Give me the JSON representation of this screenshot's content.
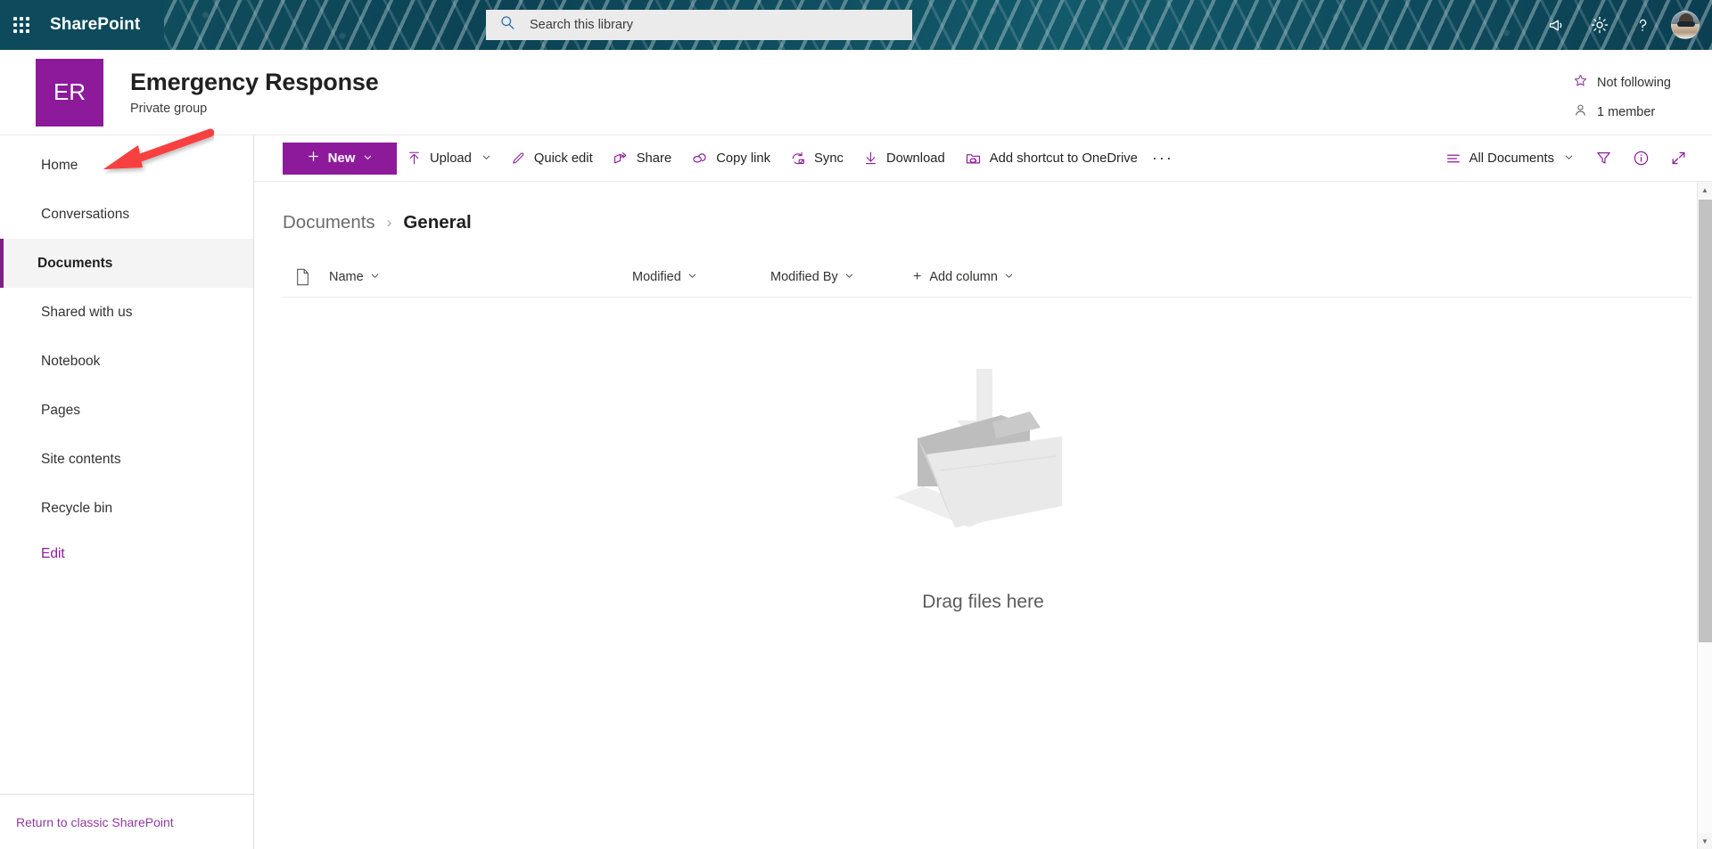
{
  "suite": {
    "brand": "SharePoint",
    "waffle_label": "app-launcher",
    "search": {
      "value": "",
      "placeholder": "Search this library"
    },
    "icons": [
      {
        "name": "megaphone-icon",
        "label": "Announcements"
      },
      {
        "name": "gear-icon",
        "label": "Settings"
      },
      {
        "name": "help-icon",
        "label": "Help"
      }
    ],
    "avatar_label": "User account"
  },
  "site": {
    "logo_initials": "ER",
    "logo_color": "#8d1a9b",
    "title": "Emergency Response",
    "subtitle": "Private group",
    "following_label": "Not following",
    "members_label": "1 member"
  },
  "sidebar": {
    "items": [
      {
        "label": "Home",
        "selected": false
      },
      {
        "label": "Conversations",
        "selected": false
      },
      {
        "label": "Documents",
        "selected": true
      },
      {
        "label": "Shared with us",
        "selected": false
      },
      {
        "label": "Notebook",
        "selected": false
      },
      {
        "label": "Pages",
        "selected": false
      },
      {
        "label": "Site contents",
        "selected": false
      },
      {
        "label": "Recycle bin",
        "selected": false
      }
    ],
    "edit_label": "Edit",
    "footer_link": "Return to classic SharePoint"
  },
  "toolbar": {
    "new_label": "New",
    "commands": [
      {
        "label": "Upload",
        "icon": "upload-icon",
        "has_chevron": true
      },
      {
        "label": "Quick edit",
        "icon": "pencil-icon",
        "has_chevron": false
      },
      {
        "label": "Share",
        "icon": "share-icon",
        "has_chevron": false
      },
      {
        "label": "Copy link",
        "icon": "link-icon",
        "has_chevron": false
      },
      {
        "label": "Sync",
        "icon": "sync-icon",
        "has_chevron": false
      },
      {
        "label": "Download",
        "icon": "download-icon",
        "has_chevron": false
      },
      {
        "label": "Add shortcut to OneDrive",
        "icon": "add-shortcut-icon",
        "has_chevron": false
      }
    ],
    "overflow_label": "···",
    "view_label": "All Documents",
    "right_icons": [
      {
        "name": "filter-icon",
        "label": "Filters"
      },
      {
        "name": "info-icon",
        "label": "Details"
      },
      {
        "name": "expand-icon",
        "label": "Expand"
      }
    ]
  },
  "breadcrumb": {
    "parent": "Documents",
    "separator": "›",
    "current": "General"
  },
  "columns": {
    "doc_icon_name": "file-type-icon",
    "headers": [
      {
        "label": "Name",
        "has_chevron": true
      },
      {
        "label": "Modified",
        "has_chevron": true
      },
      {
        "label": "Modified By",
        "has_chevron": true
      }
    ],
    "add_column_label": "Add column",
    "add_column_plus": "+"
  },
  "empty_state": {
    "illustration": "folder-drop-icon",
    "caption": "Drag files here"
  },
  "annotation": {
    "arrow_color": "#f94141",
    "points_to": "Home"
  },
  "colors": {
    "accent": "#8d1a9b",
    "suite_bar": "#0e4a5c",
    "selected_nav_bg": "#f4f4f4",
    "annotation_red": "#f94141"
  }
}
